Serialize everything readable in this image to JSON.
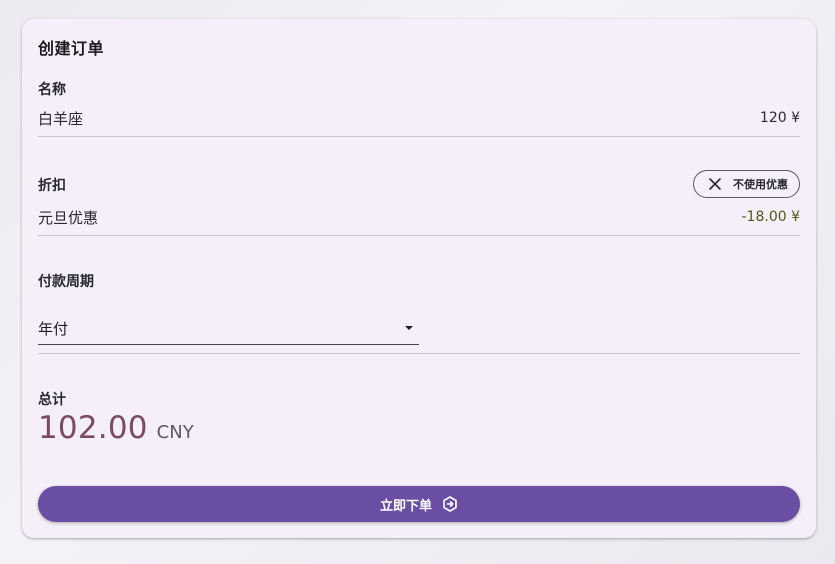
{
  "order": {
    "title": "创建订单",
    "name_section": {
      "label": "名称",
      "product_name": "白羊座",
      "price": "120 ¥"
    },
    "discount_section": {
      "label": "折扣",
      "no_coupon_label": "不使用优惠",
      "coupon_name": "元旦优惠",
      "discount_amount": "-18.00 ¥"
    },
    "billing_section": {
      "label": "付款周期",
      "selected_option": "年付"
    },
    "total_section": {
      "label": "总计",
      "amount": "102.00",
      "currency": "CNY"
    },
    "submit_label": "立即下单"
  },
  "icons": {
    "close_chip_icon": "close-icon",
    "submit_icon": "arrow-right-circle-icon",
    "select_caret": "caret-down-icon"
  },
  "colors": {
    "primary_button": "#6a4ea3",
    "total_amount": "#7b4b62",
    "discount_value": "#4f5a1a",
    "card_background": "#f4eff8"
  }
}
